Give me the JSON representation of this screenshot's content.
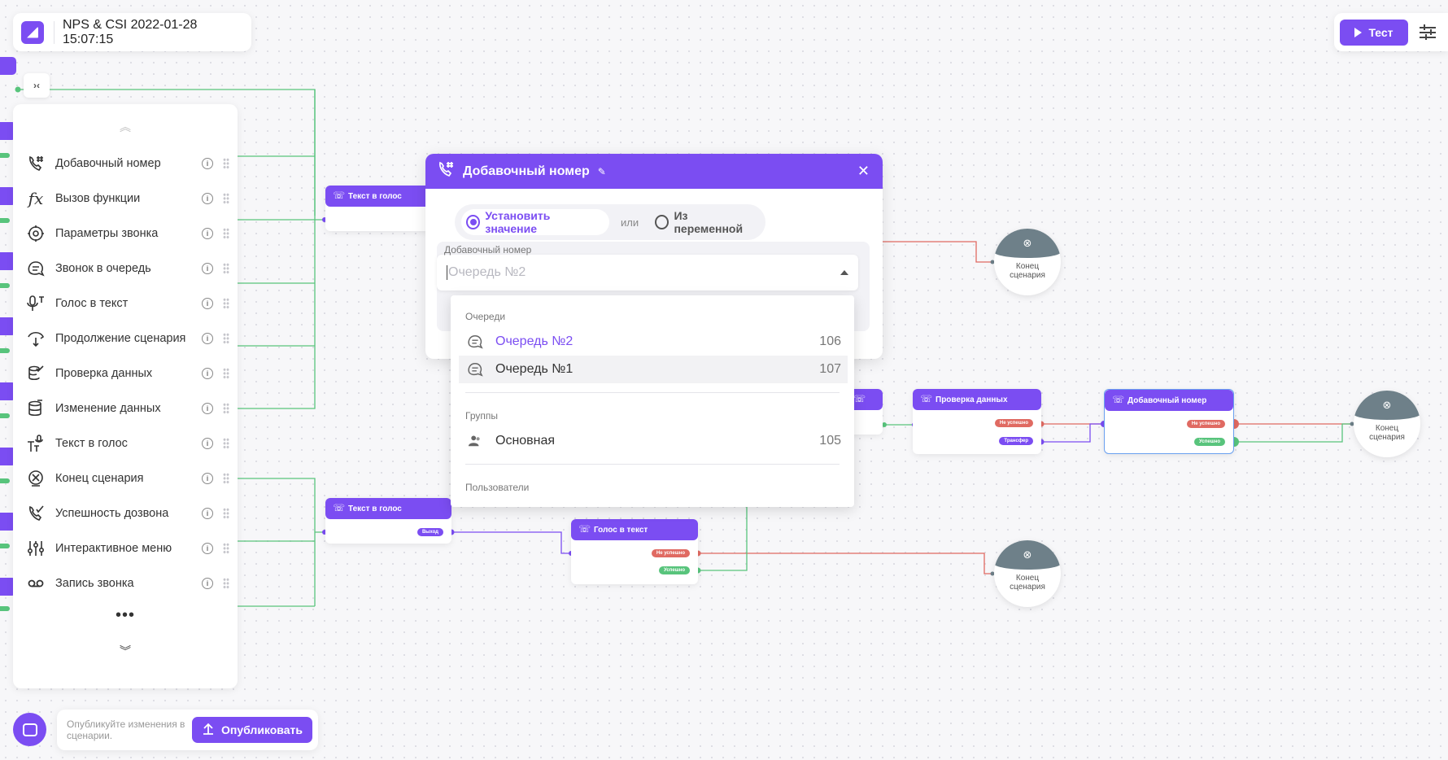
{
  "app": {
    "title": "NPS & CSI 2022-01-28 15:07:15",
    "test_label": "Тест",
    "collapse_label": "›‹"
  },
  "palette": {
    "items": [
      {
        "label": "Добавочный номер",
        "icon": "phone-hash-icon"
      },
      {
        "label": "Вызов функции",
        "icon": "function-icon"
      },
      {
        "label": "Параметры звонка",
        "icon": "call-settings-icon"
      },
      {
        "label": "Звонок в очередь",
        "icon": "queue-icon"
      },
      {
        "label": "Голос в текст",
        "icon": "voice-to-text-icon"
      },
      {
        "label": "Продолжение сценария",
        "icon": "continue-icon"
      },
      {
        "label": "Проверка данных",
        "icon": "check-data-icon"
      },
      {
        "label": "Изменение данных",
        "icon": "edit-data-icon"
      },
      {
        "label": "Текст в голос",
        "icon": "text-to-voice-icon"
      },
      {
        "label": "Конец сценария",
        "icon": "end-icon"
      },
      {
        "label": "Успешность дозвона",
        "icon": "call-success-icon"
      },
      {
        "label": "Интерактивное меню",
        "icon": "menu-sliders-icon"
      },
      {
        "label": "Запись звонка",
        "icon": "record-icon"
      }
    ],
    "info_glyph": "i",
    "more": "•••",
    "scroll_up": "︽",
    "scroll_down": "︾"
  },
  "publish": {
    "hint": "Опубликуйте изменения в сценарии.",
    "button": "Опубликовать"
  },
  "nodes": {
    "tts1": "Текст в голос",
    "tts2": "Текст в голос",
    "stt": "Голос в текст",
    "check": "Проверка данных",
    "ext": "Добавочный номер",
    "exit_label": "Выход",
    "fail_label": "Не успешно",
    "ok_label": "Успешно",
    "transfer_label": "Трансфер",
    "end_line1": "Конец",
    "end_line2": "сценария"
  },
  "modal": {
    "title": "Добавочный номер",
    "radio_set": "Установить значение",
    "or": "или",
    "radio_var": "Из переменной",
    "field_label": "Добавочный номер",
    "field_value": "Очередь №2"
  },
  "dropdown": {
    "group_queues": "Очереди",
    "queues": [
      {
        "name": "Очередь №2",
        "num": "106"
      },
      {
        "name": "Очередь №1",
        "num": "107"
      }
    ],
    "group_groups": "Группы",
    "groups": [
      {
        "name": "Основная",
        "num": "105"
      }
    ],
    "group_users": "Пользователи"
  },
  "colors": {
    "accent": "#7b4df2",
    "success": "#58c47c",
    "fail": "#e06a62",
    "end_node": "#6e8089"
  }
}
